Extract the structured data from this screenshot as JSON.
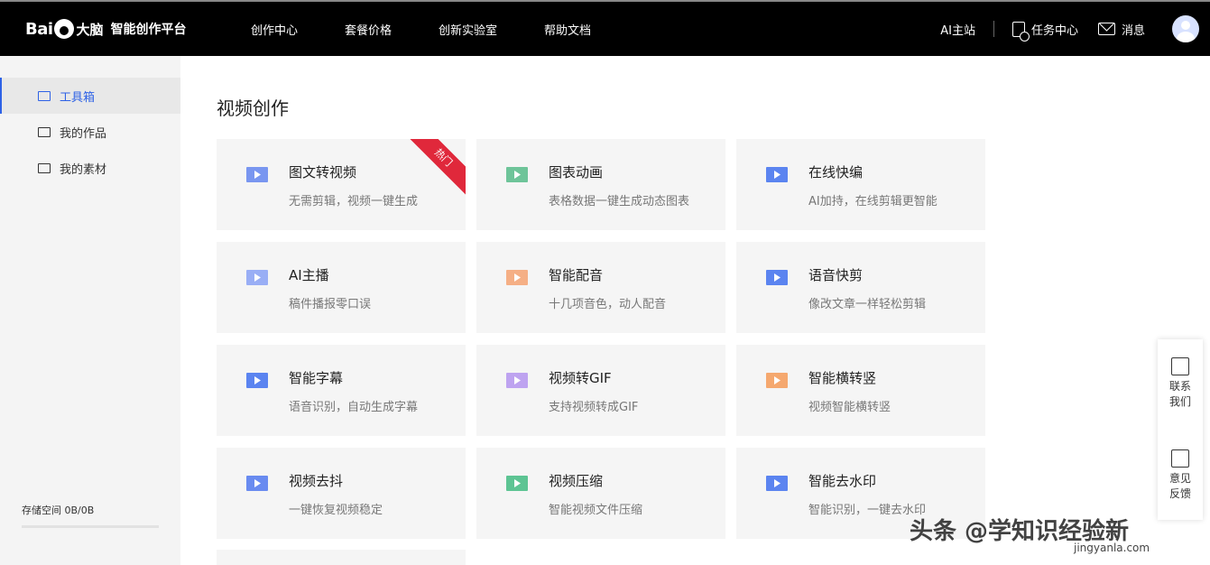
{
  "header": {
    "logo_text": "Bai",
    "logo_cn": "大脑",
    "platform_name": "智能创作平台",
    "nav": [
      "创作中心",
      "套餐价格",
      "创新实验室",
      "帮助文档"
    ],
    "ai_site": "AI主站",
    "task_center": "任务中心",
    "messages": "消息"
  },
  "sidebar": {
    "items": [
      {
        "label": "工具箱",
        "icon": "toolbox-icon",
        "active": true
      },
      {
        "label": "我的作品",
        "icon": "works-icon",
        "active": false
      },
      {
        "label": "我的素材",
        "icon": "folder-icon",
        "active": false
      }
    ],
    "storage": "存储空间 0B/0B"
  },
  "main": {
    "section_title": "视频创作",
    "hot_badge": "热门",
    "cards": [
      {
        "title": "图文转视频",
        "desc": "无需剪辑，视频一键生成",
        "icon": "image-to-video-icon",
        "color": "#6b8cf0"
      },
      {
        "title": "图表动画",
        "desc": "表格数据一键生成动态图表",
        "icon": "chart-animation-icon",
        "color": "#5fbf8f"
      },
      {
        "title": "在线快编",
        "desc": "AI加持，在线剪辑更智能",
        "icon": "online-edit-icon",
        "color": "#4a78f0"
      },
      {
        "title": "AI主播",
        "desc": "稿件播报零口误",
        "icon": "ai-anchor-icon",
        "color": "#8fa6f5"
      },
      {
        "title": "智能配音",
        "desc": "十几项音色，动人配音",
        "icon": "dubbing-icon",
        "color": "#f5a779"
      },
      {
        "title": "语音快剪",
        "desc": "像改文章一样轻松剪辑",
        "icon": "voice-cut-icon",
        "color": "#4a78f0"
      },
      {
        "title": "智能字幕",
        "desc": "语音识别，自动生成字幕",
        "icon": "subtitle-icon",
        "color": "#4a78f0"
      },
      {
        "title": "视频转GIF",
        "desc": "支持视频转成GIF",
        "icon": "video-to-gif-icon",
        "color": "#b89af0"
      },
      {
        "title": "智能横转竖",
        "desc": "视频智能横转竖",
        "icon": "horizontal-to-vertical-icon",
        "color": "#f5a060"
      },
      {
        "title": "视频去抖",
        "desc": "一键恢复视频稳定",
        "icon": "stabilize-icon",
        "color": "#5a7ff0"
      },
      {
        "title": "视频压缩",
        "desc": "智能视频文件压缩",
        "icon": "compress-icon",
        "color": "#4dbf88"
      },
      {
        "title": "智能去水印",
        "desc": "智能识别，一键去水印",
        "icon": "remove-watermark-icon",
        "color": "#4a78f0"
      }
    ]
  },
  "float_panel": {
    "contact": [
      "联系",
      "我们"
    ],
    "feedback": [
      "意见",
      "反馈"
    ]
  },
  "watermark": {
    "text": "头条 @学知识经验新",
    "sub": "jingyanla.com"
  }
}
